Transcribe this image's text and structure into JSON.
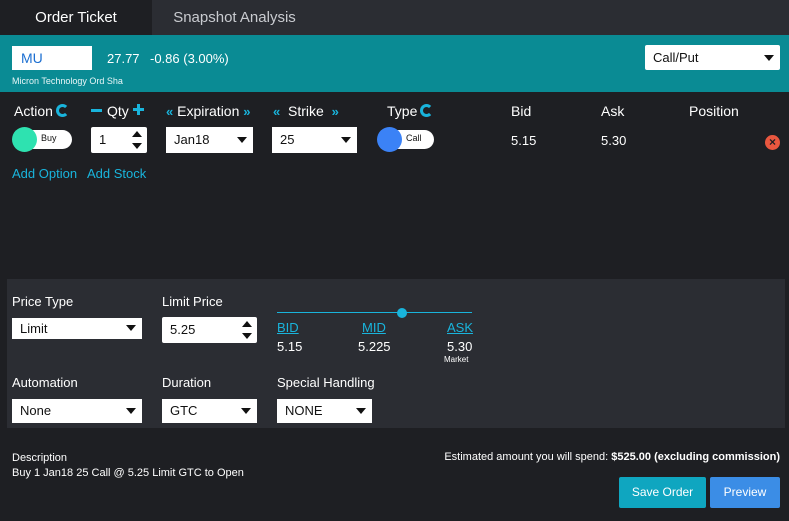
{
  "tabs": [
    {
      "label": "Order Ticket",
      "active": true
    },
    {
      "label": "Snapshot Analysis",
      "active": false
    }
  ],
  "header": {
    "symbol": "MU",
    "last_price": "27.77",
    "change": "-0.86 (3.00%)",
    "company": "Micron Technology Ord Sha",
    "strategy_select": "Call/Put"
  },
  "columns": {
    "action": "Action",
    "qty": "Qty",
    "expiration": "Expiration",
    "strike": "Strike",
    "type": "Type",
    "bid": "Bid",
    "ask": "Ask",
    "position": "Position"
  },
  "leg": {
    "action": "Buy",
    "qty": "1",
    "expiration": "Jan18",
    "strike": "25",
    "type": "Call",
    "bid": "5.15",
    "ask": "5.30",
    "position": ""
  },
  "links": {
    "add_option": "Add Option",
    "add_stock": "Add Stock"
  },
  "order": {
    "price_type_label": "Price Type",
    "price_type": "Limit",
    "limit_price_label": "Limit Price",
    "limit_price": "5.25",
    "automation_label": "Automation",
    "automation": "None",
    "duration_label": "Duration",
    "duration": "GTC",
    "special_handling_label": "Special Handling",
    "special_handling": "NONE"
  },
  "quote": {
    "bid_label": "BID",
    "bid": "5.15",
    "mid_label": "MID",
    "mid": "5.225",
    "ask_label": "ASK",
    "ask": "5.30",
    "market_label": "Market",
    "slider_position": 0.64
  },
  "footer": {
    "description_label": "Description",
    "description": "Buy 1 Jan18 25 Call @ 5.25 Limit GTC to Open",
    "estimate_prefix": "Estimated amount you will spend:",
    "estimate_amount": "$525.00 (excluding commission)",
    "save_button": "Save Order",
    "preview_button": "Preview"
  },
  "colors": {
    "accent": "#19b4dc",
    "header": "#0a8b94",
    "buy_toggle": "#2ee2b0",
    "call_toggle": "#3b82f6",
    "remove": "#e9573f",
    "save_button": "#0fa6c0",
    "preview_button": "#3b8de6"
  }
}
